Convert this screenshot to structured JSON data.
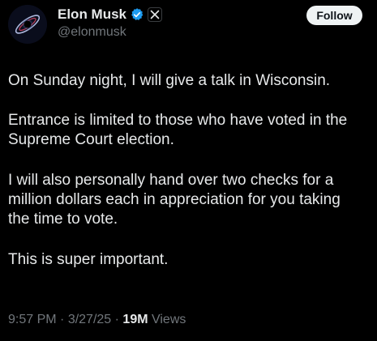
{
  "author": {
    "display_name": "Elon Musk",
    "handle": "@elonmusk",
    "avatar_icon": "black-hole-avatar",
    "verified_icon": "verified-badge-icon",
    "affiliation_icon": "x-logo-icon",
    "verified_color": "#1d9bf0"
  },
  "follow_label": "Follow",
  "tweet": {
    "paragraphs": [
      "On Sunday night, I will give a talk in Wisconsin.",
      "Entrance is limited to those who have voted in the\nSupreme Court election.",
      "I will also personally hand over two checks for a\nmillion dollars each in appreciation for you taking\nthe time to vote.",
      "This is super important."
    ]
  },
  "meta": {
    "time": "9:57 PM",
    "separator": " · ",
    "date": "3/27/25",
    "views_count": "19M",
    "views_label": " Views"
  },
  "colors": {
    "background": "#000000",
    "text_primary": "#e7e9ea",
    "text_secondary": "#71767b",
    "follow_bg": "#eff3f4",
    "follow_text": "#0f1419"
  }
}
